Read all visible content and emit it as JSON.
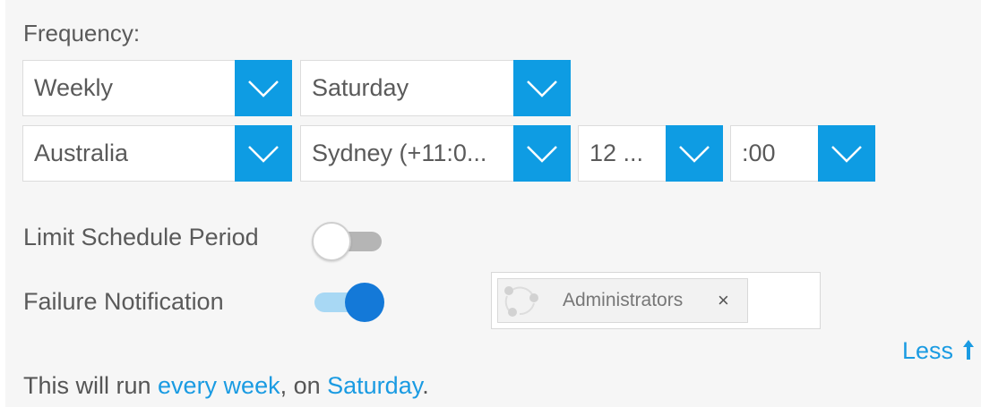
{
  "frequency_label": "Frequency:",
  "dropdowns": {
    "frequency": "Weekly",
    "day": "Saturday",
    "region": "Australia",
    "timezone": "Sydney (+11:0...",
    "hour": "12 ...",
    "minute": ":00"
  },
  "limit_schedule": {
    "label": "Limit Schedule Period",
    "on": false
  },
  "failure_notification": {
    "label": "Failure Notification",
    "on": true,
    "recipients": [
      {
        "label": "Administrators",
        "remove": "×"
      }
    ]
  },
  "less_link": "Less",
  "less_icon": "arrow-up-icon",
  "summary": {
    "prefix": "This will run ",
    "frequency": "every week",
    "middle": ", on ",
    "day": "Saturday",
    "suffix": "."
  },
  "colors": {
    "accent": "#0e9ce3",
    "link": "#1a9be2",
    "toggle_on": "#1479d8",
    "panel_bg": "#f6f6f6"
  }
}
